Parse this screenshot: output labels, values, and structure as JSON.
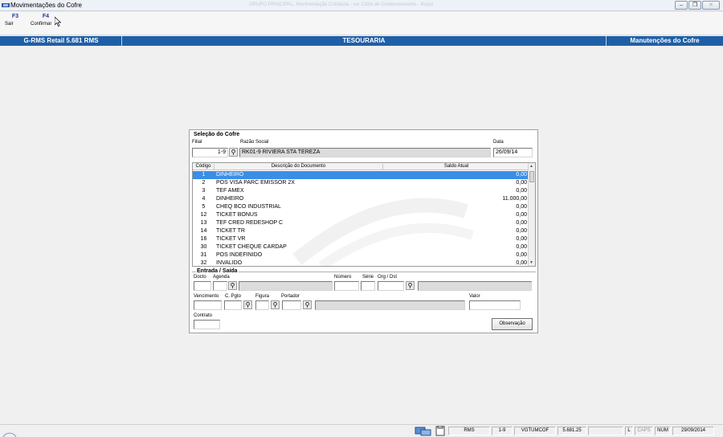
{
  "window": {
    "title": "Movimentações do Cofre",
    "faint_title": "GRUPO PRINCIPAL, Movimentação Cotidiana - ver Cofre de Credenciamento - Braço",
    "controls": [
      "–",
      "❐",
      "✕"
    ]
  },
  "toolbar": {
    "buttons": [
      {
        "key": "F3",
        "label": "Sair"
      },
      {
        "key": "F4",
        "label": "Confirmar"
      }
    ]
  },
  "header": {
    "left": "G-RMS Retail 5.681 RMS",
    "center": "TESOURARIA",
    "right": "Manutenções do Cofre"
  },
  "selecao": {
    "title": "Seleção do Cofre",
    "filial_label": "Filial",
    "filial_value": "1-9",
    "razao_label": "Razão Social",
    "razao_value": "RK01-9 RIVIERA STA TEREZA",
    "data_label": "Data",
    "data_value": "26/09/14"
  },
  "grid": {
    "columns": [
      "Código",
      "Descrição do Documento",
      "Saldo Atual"
    ],
    "rows": [
      {
        "codigo": "1",
        "descricao": "DINHEIRO",
        "saldo": "0,00"
      },
      {
        "codigo": "2",
        "descricao": "POS VISA PARC EMISSOR  2X",
        "saldo": "0,00"
      },
      {
        "codigo": "3",
        "descricao": "TEF AMEX",
        "saldo": "0,00"
      },
      {
        "codigo": "4",
        "descricao": "DINHEIRO",
        "saldo": "11.000,00"
      },
      {
        "codigo": "5",
        "descricao": "CHEQ BCO INDUSTRIAL",
        "saldo": "0,00"
      },
      {
        "codigo": "12",
        "descricao": "TICKET BONUS",
        "saldo": "0,00"
      },
      {
        "codigo": "13",
        "descricao": "TEF CRED REDESHOP C",
        "saldo": "0,00"
      },
      {
        "codigo": "14",
        "descricao": "TICKET TR",
        "saldo": "0,00"
      },
      {
        "codigo": "16",
        "descricao": "TICKET VR",
        "saldo": "0,00"
      },
      {
        "codigo": "30",
        "descricao": "TICKET CHEQUE CARDAP",
        "saldo": "0,00"
      },
      {
        "codigo": "31",
        "descricao": "POS INDEFINIDO",
        "saldo": "0,00"
      },
      {
        "codigo": "32",
        "descricao": "INVALIDO",
        "saldo": "0,00"
      }
    ]
  },
  "entrada": {
    "title": "Entrada / Saída",
    "docto_label": "Docto",
    "agenda_label": "Agenda",
    "numero_label": "Número",
    "serie_label": "Série",
    "org_dst_label": "Org / Dst",
    "vencimento_label": "Vencimento",
    "cpgto_label": "C. Pgto",
    "figura_label": "Figura",
    "portador_label": "Portador",
    "valor_label": "Valor",
    "contrato_label": "Contrato",
    "observacao_button": "Observação"
  },
  "statusbar": {
    "system": "RMS",
    "filial": "1-9",
    "program": "VGTUMCOF",
    "version": "5.681.25",
    "l": "L",
    "caps": "CAPS",
    "num": "NUM",
    "date": "29/09/2014"
  },
  "colors": {
    "header_blue": "#1f5fa8",
    "selection_blue": "#3a8ee6"
  }
}
